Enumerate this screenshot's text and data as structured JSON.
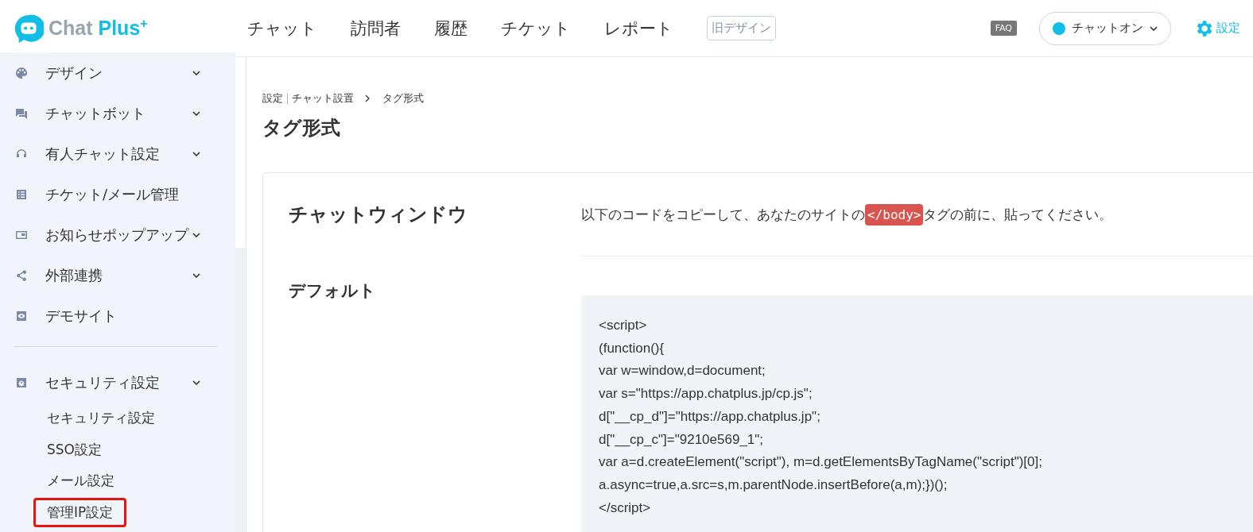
{
  "header": {
    "logo_text": "Chat",
    "logo_accent": "Plus",
    "logo_plus": "+",
    "nav": [
      {
        "label": "チャット",
        "selected": false
      },
      {
        "label": "訪問者",
        "selected": false
      },
      {
        "label": "履歴",
        "selected": false
      },
      {
        "label": "チケット",
        "selected": false
      },
      {
        "label": "レポート",
        "selected": false
      }
    ],
    "old_design": "旧デザイン",
    "faq": "FAQ",
    "status": {
      "label": "チャットオン",
      "on": true
    },
    "settings": "設定"
  },
  "sidebar": {
    "items": [
      {
        "label": "デザイン",
        "expandable": true
      },
      {
        "label": "チャットボット",
        "expandable": true
      },
      {
        "label": "有人チャット設定",
        "expandable": true
      },
      {
        "label": "チケット/メール管理",
        "expandable": false
      },
      {
        "label": "お知らせポップアップ",
        "expandable": true
      },
      {
        "label": "外部連携",
        "expandable": true
      },
      {
        "label": "デモサイト",
        "expandable": false
      }
    ],
    "section": {
      "label": "セキュリティ設定",
      "expanded": true,
      "children": [
        {
          "label": "セキュリティ設定",
          "highlighted": false
        },
        {
          "label": "SSO設定",
          "highlighted": false
        },
        {
          "label": "メール設定",
          "highlighted": false
        },
        {
          "label": "管理IP設定",
          "highlighted": true
        }
      ]
    }
  },
  "breadcrumb": [
    "設定",
    "チャット設置",
    "タグ形式"
  ],
  "page_title": "タグ形式",
  "card": {
    "section_title": "チャットウィンドウ",
    "instruction_before": "以下のコードをコピーして、あなたのサイトの",
    "instruction_tag": "</body>",
    "instruction_after": "タグの前に、貼ってください。",
    "default_label": "デフォルト",
    "code_lines": [
      "<script>",
      "(function(){",
      "var w=window,d=document;",
      "var s=\"https://app.chatplus.jp/cp.js\";",
      "d[\"__cp_d\"]=\"https://app.chatplus.jp\";",
      "d[\"__cp_c\"]=\"9210e569_1\";",
      "var a=d.createElement(\"script\"), m=d.getElementsByTagName(\"script\")[0];",
      "a.async=true,a.src=s,m.parentNode.insertBefore(a,m);})();",
      "</script>"
    ]
  }
}
